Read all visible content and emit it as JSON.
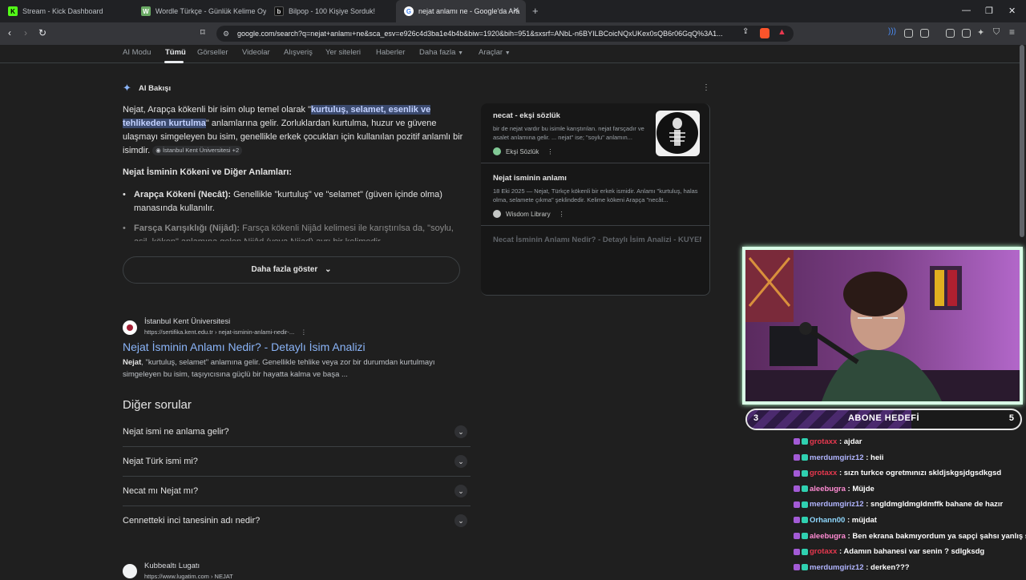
{
  "browser": {
    "tabs": [
      {
        "title": "Stream - Kick Dashboard",
        "icon": "kick-icon"
      },
      {
        "title": "Wordle Türkçe - Günlük Kelime Oyun",
        "icon": "wordle-icon"
      },
      {
        "title": "Bilpop - 100 Kişiye Sorduk!",
        "icon": "bilpop-icon"
      },
      {
        "title": "nejat anlamı ne - Google'da Ara",
        "icon": "google-icon"
      }
    ],
    "new_tab": "+",
    "url": "google.com/search?q=nejat+anlamı+ne&sca_esv=e926c4d3ba1e4b4b&biw=1920&bih=951&sxsrf=ANbL-n6BYILBCoicNQxUKex0sQB6r06GqQ%3A1..."
  },
  "google": {
    "tabs": [
      "AI Modu",
      "Tümü",
      "Görseller",
      "Videolar",
      "Alışveriş",
      "Yer siteleri",
      "Haberler",
      "Daha fazla",
      "Araçlar"
    ],
    "ai_label": "AI Bakışı",
    "ai_para": {
      "p1": "Nejat, Arapça kökenli bir isim olup temel olarak \"",
      "hl": "kurtuluş, selamet, esenlik ve tehlikeden kurtulma",
      "p2": "\" anlamlarına gelir. Zorluklardan kurtulma, huzur ve güvene ulaşmayı simgeleyen bu isim, genellikle erkek çocukları için kullanılan pozitif anlamlı bir isimdir.",
      "source": "İstanbul Kent Üniversitesi +2"
    },
    "heading": "Nejat İsminin Kökeni ve Diğer Anlamları:",
    "bullet1_b": "Arapça Kökeni (Necât):",
    "bullet1": " Genellikle \"kurtuluş\" ve \"selamet\" (güven içinde olma) manasında kullanılır.",
    "bullet2_b": "Farsça Karışıklığı (Nijâd):",
    "bullet2": " Farsça kökenli Nijâd kelimesi ile karıştırılsa da, \"soylu, asil, köken\" anlamına gelen Nijâd (veya Nijad) ayrı bir kelimedir.",
    "more_btn": "Daha fazla göster",
    "side": {
      "c1_title": "necat - ekşi sözlük",
      "c1_snip": "bir de nejat vardır bu isimle karıştırılan. nejat farsçadır ve asalet anlamına gelir. ... nejat\" ise; \"soylu\" anlamın...",
      "c1_src": "Ekşi Sözlük",
      "c2_title": "Nejat isminin anlamı",
      "c2_snip": "18 Eki 2025 — Nejat, Türkçe kökenli bir erkek ismidir. Anlamı \"kurtuluş, halas olma, selamete çıkma\" şeklindedir. Kelime kökeni Arapça \"necât...",
      "c2_src": "Wisdom Library",
      "c3_title": "Necat İsminin Anlamı Nedir? - Detaylı İsim Analizi - KUYEM"
    },
    "result": {
      "site": "İstanbul Kent Üniversitesi",
      "url": "https://sertifika.kent.edu.tr › nejat-isminin-anlami-nedir-...",
      "title": "Nejat İsminin Anlamı Nedir? - Detaylı İsim Analizi",
      "snip_b": "Nejat",
      "snip": ", \"kurtuluş, selamet\" anlamına gelir. Genellikle tehlike veya zor bir durumdan kurtulmayı simgeleyen bu isim, taşıyıcısına güçlü bir hayatta kalma ve başa ..."
    },
    "other_q": "Diğer sorular",
    "faqs": [
      "Nejat ismi ne anlama gelir?",
      "Nejat Türk ismi mi?",
      "Necat mı Nejat mı?",
      "Cennetteki inci tanesinin adı nedir?"
    ],
    "next_site": "Kubbealtı Lugatı",
    "next_url": "https://www.lugatim.com › NEJAT"
  },
  "stream": {
    "goal_label": "ABONE HEDEFİ",
    "goal_current": "3",
    "goal_target": "5",
    "goal_fraction": 0.6,
    "chat": [
      {
        "user": "grotaxx",
        "msg": " : ajdar",
        "color": "#e8384f"
      },
      {
        "user": "merdumgiriz12",
        "msg": " : heii",
        "color": "#b1b5ff"
      },
      {
        "user": "grotaxx",
        "msg": " : sızn turkce ogretmınızı skldjskgsjdgsdkgsd",
        "color": "#e8384f"
      },
      {
        "user": "aleebugra",
        "msg": " : Müjde",
        "color": "#ff8bd3"
      },
      {
        "user": "merdumgiriz12",
        "msg": " : sngldmgldmgldmffk bahane de hazır",
        "color": "#b1b5ff"
      },
      {
        "user": "Orhann00",
        "msg": " : müjdat",
        "color": "#8fd8ff"
      },
      {
        "user": "aleebugra",
        "msg": " : Ben ekrana bakmıyordum ya sapçi şahsı yanlış s",
        "color": "#ff8bd3"
      },
      {
        "user": "grotaxx",
        "msg": " : Adamın bahanesi var senin ? sdlgksdg",
        "color": "#e8384f"
      },
      {
        "user": "merdumgiriz12",
        "msg": " : derken???",
        "color": "#b1b5ff"
      }
    ]
  }
}
